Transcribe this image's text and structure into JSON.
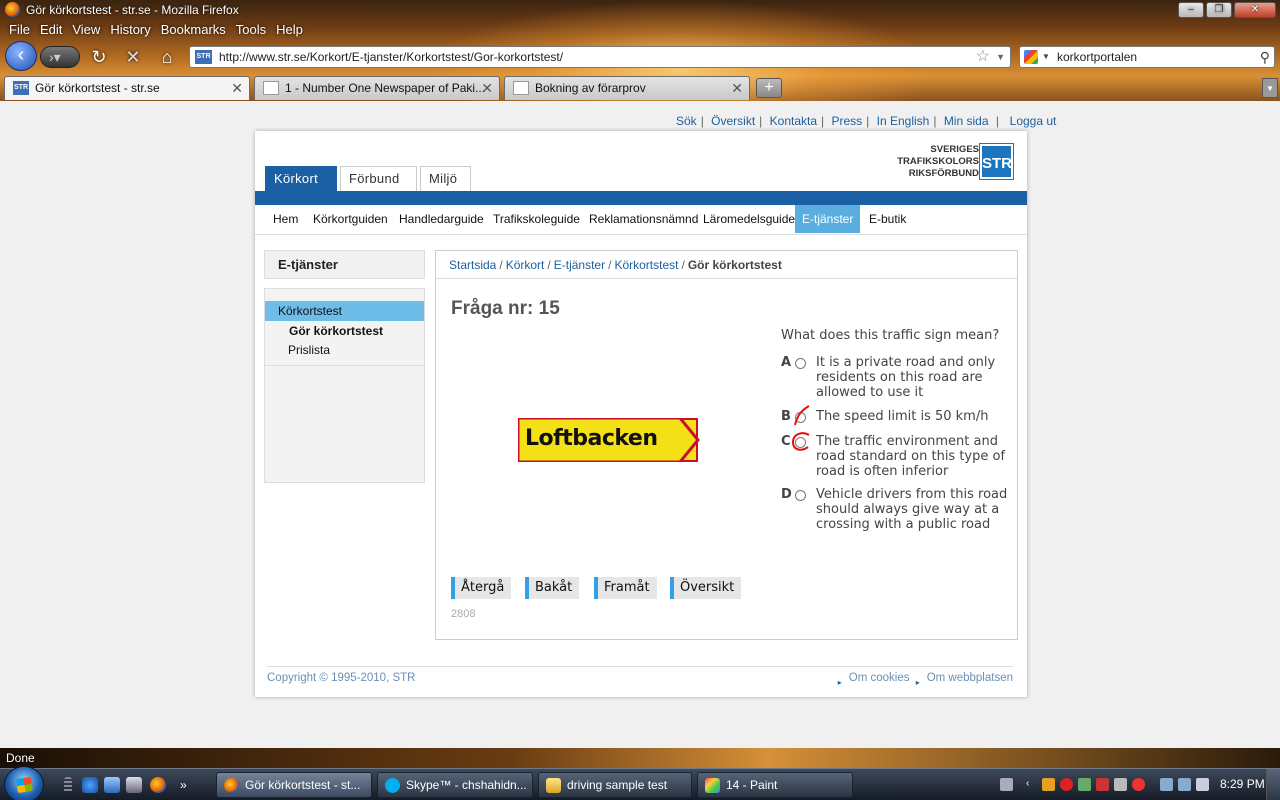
{
  "window": {
    "title": "Gör körkortstest - str.se - Mozilla Firefox"
  },
  "menu": [
    "File",
    "Edit",
    "View",
    "History",
    "Bookmarks",
    "Tools",
    "Help"
  ],
  "toolbar": {
    "url": "http://www.str.se/Korkort/E-tjanster/Korkortstest/Gor-korkortstest/",
    "site_icon": "STR",
    "search_value": "korkortportalen"
  },
  "tabs": [
    {
      "label": "Gör körkortstest - str.se",
      "active": true
    },
    {
      "label": "1 - Number One Newspaper of Paki...",
      "active": false
    },
    {
      "label": "Bokning av förarprov",
      "active": false
    }
  ],
  "site": {
    "toplinks": [
      "Sök",
      "Översikt",
      "Kontakta",
      "Press",
      "In English",
      "Min sida",
      "Logga ut"
    ],
    "logo": {
      "lines": [
        "SVERIGES",
        "TRAFIKSKOLORS",
        "RIKSFÖRBUND"
      ],
      "badge": "STR"
    },
    "main_tabs": [
      "Körkort",
      "Förbund",
      "Miljö"
    ],
    "subnav": [
      "Hem",
      "Körkortguiden",
      "Handledarguide",
      "Trafikskoleguide",
      "Reklamationsnämnd",
      "Läromedelsguide",
      "E-tjänster",
      "E-butik"
    ],
    "sidebar": {
      "title": "E-tjänster",
      "selected": "Körkortstest",
      "current": "Gör körkortstest",
      "other": "Prislista"
    },
    "breadcrumbs": [
      "Startsida",
      "Körkort",
      "E-tjänster",
      "Körkortstest"
    ],
    "breadcrumb_current": "Gör körkortstest",
    "question": {
      "title": "Fråga nr: 15",
      "sign_text": "Loftbacken",
      "text": "What does this traffic sign mean?",
      "options": [
        {
          "letter": "A",
          "text": "It is a private road and only residents on this road are allowed to use it"
        },
        {
          "letter": "B",
          "text": "The speed limit is 50 km/h"
        },
        {
          "letter": "C",
          "text": "The traffic environment and road standard on this type of road is often inferior"
        },
        {
          "letter": "D",
          "text": "Vehicle drivers from this road should always give way at a crossing with a public road"
        }
      ]
    },
    "buttons": [
      "Återgå",
      "Bakåt",
      "Framåt",
      "Översikt"
    ],
    "question_id": "2808",
    "footer": {
      "copyright": "Copyright © 1995-2010, STR",
      "links": [
        "Om cookies",
        "Om webbplatsen"
      ]
    }
  },
  "status": "Done",
  "taskbar": {
    "items": [
      "Gör körkortstest - st...",
      "Skype™ - chshahidn...",
      "driving sample test",
      "14 - Paint"
    ],
    "clock": "8:29 PM"
  }
}
